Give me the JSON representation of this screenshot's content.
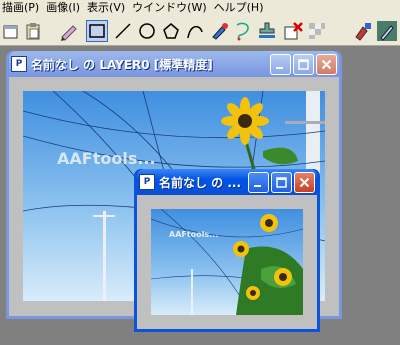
{
  "menubar": {
    "items": [
      "描画(P)",
      "画像(I)",
      "表示(V)",
      "ウインドウ(W)",
      "ヘルプ(H)"
    ]
  },
  "toolbar": {
    "tools": [
      "new-icon",
      "paste-icon",
      "pen-icon",
      "rectangle-icon",
      "line-icon",
      "circle-icon",
      "polygon-icon",
      "curve-icon",
      "brush-icon",
      "select-lasso-icon",
      "stamp-icon",
      "fill-icon",
      "erase-icon",
      "pattern-icon",
      "spray-icon",
      "dropper-icon"
    ]
  },
  "big_window": {
    "title": "名前なし の LAYER0 [標準精度]",
    "watermark": "AAFtools..."
  },
  "small_window": {
    "title": "名前なし の ...",
    "watermark": "AAFtools..."
  },
  "colors": {
    "sky_top": "#3f8fe0",
    "sky_bottom": "#d8ecfa",
    "sunflower": "#f2c20c"
  }
}
